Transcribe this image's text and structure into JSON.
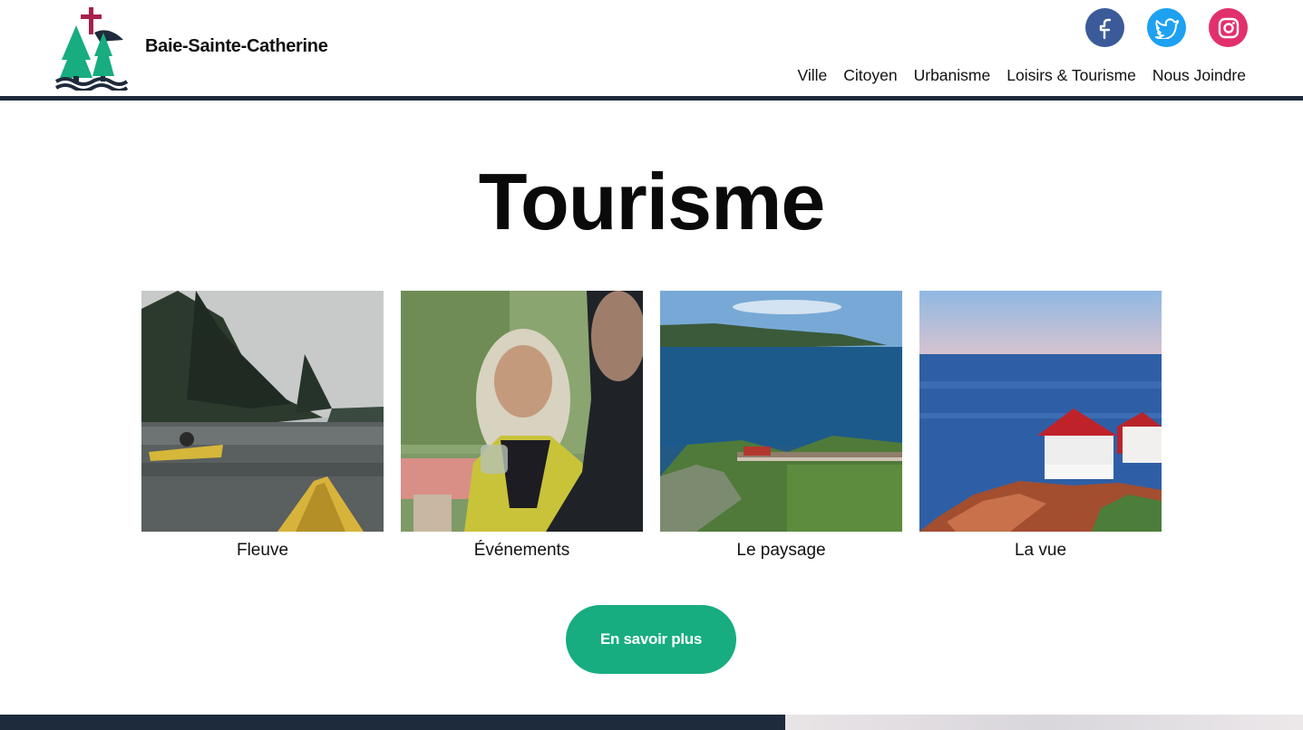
{
  "header": {
    "brand_name": "Baie-Sainte-Catherine",
    "logo_icon": "tree-cross-waves-logo",
    "socials": [
      {
        "name": "facebook",
        "icon": "facebook-icon",
        "color": "#3b5a9a"
      },
      {
        "name": "twitter",
        "icon": "twitter-icon",
        "color": "#1da1f2"
      },
      {
        "name": "instagram",
        "icon": "instagram-icon",
        "color": "#e1306c"
      }
    ],
    "nav": [
      "Ville",
      "Citoyen",
      "Urbanisme",
      "Loisirs & Tourisme",
      "Nous Joindre"
    ]
  },
  "main": {
    "title": "Tourisme",
    "cards": [
      {
        "caption": "Fleuve"
      },
      {
        "caption": "Événements"
      },
      {
        "caption": "Le paysage"
      },
      {
        "caption": "La vue"
      }
    ],
    "cta_label": "En savoir plus"
  },
  "colors": {
    "accent": "#17ad80",
    "header_rule": "#1e2b3c",
    "footer": "#1e2b3c"
  }
}
